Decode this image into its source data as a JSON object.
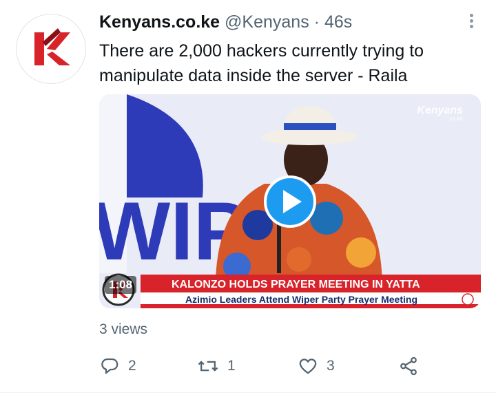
{
  "tweet": {
    "author_name": "Kenyans.co.ke",
    "handle": "@Kenyans",
    "separator": "·",
    "time": "46s",
    "text": "There are 2,000 hackers currently trying to manipulate data inside the server - Raila",
    "avatar_letter": "K"
  },
  "media": {
    "type": "video",
    "duration": "1:08",
    "watermark": "Kenyans",
    "watermark_sub": ".co.ke",
    "backdrop_text": "WIPER",
    "headline": "KALONZO HOLDS PRAYER MEETING IN YATTA",
    "subheadline": "Azimio Leaders Attend Wiper Party Prayer Meeting",
    "play_icon": "play-icon"
  },
  "stats": {
    "views": "3 views"
  },
  "actions": {
    "reply_count": "2",
    "retweet_count": "1",
    "like_count": "3"
  },
  "colors": {
    "brand_red": "#d8232a",
    "accent_blue": "#1d9bf0",
    "text_secondary": "#536471"
  }
}
